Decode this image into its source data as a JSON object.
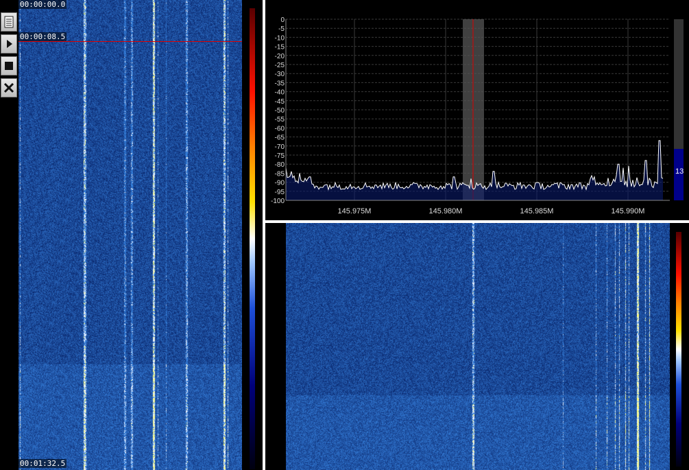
{
  "toolbar": {
    "buttons": [
      {
        "name": "notes-button",
        "icon": "document-icon"
      },
      {
        "name": "play-button",
        "icon": "play-icon"
      },
      {
        "name": "stop-button",
        "icon": "stop-icon"
      },
      {
        "name": "settings-button",
        "icon": "tools-icon"
      }
    ]
  },
  "waterfall_left": {
    "time_start": "00:00:00.0",
    "time_cursor": "00:00:08.5",
    "time_end": "00:01:32.5"
  },
  "spectrum": {
    "y_ticks": [
      "0",
      "-5",
      "-10",
      "-15",
      "-20",
      "-25",
      "-30",
      "-35",
      "-40",
      "-45",
      "-50",
      "-55",
      "-60",
      "-65",
      "-70",
      "-75",
      "-80",
      "-85",
      "-90",
      "-95",
      "-100"
    ],
    "x_ticks": [
      "145.975M",
      "145.980M",
      "145.985M",
      "145.990M"
    ],
    "level_value": "13",
    "level_fraction": 0.13
  },
  "colors": {
    "background": "#000000",
    "waterfall_blue": "#1a3fb0",
    "cursor": "#dd0000",
    "grid": "#3a3a3a"
  }
}
